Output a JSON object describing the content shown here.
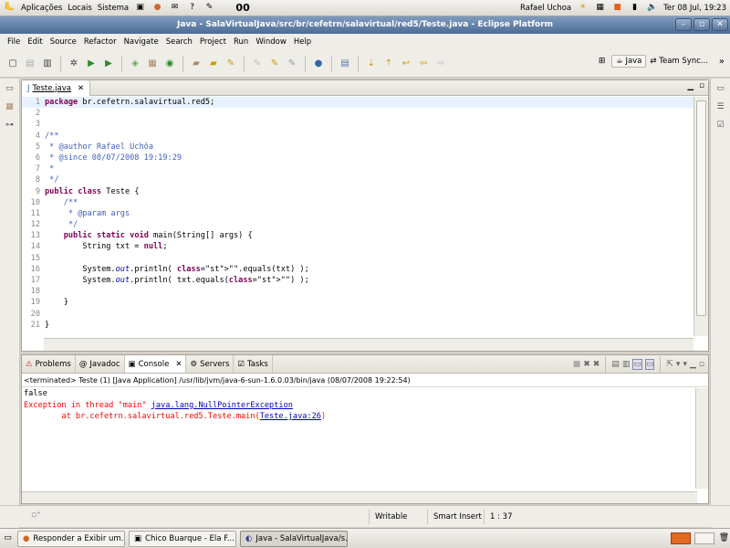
{
  "top_panel": {
    "menus": [
      "Aplicações",
      "Locais",
      "Sistema"
    ],
    "user": "Rafael Uchoa",
    "clock": "Ter 08 Jul, 19:23"
  },
  "window": {
    "title": "Java - SalaVirtualJava/src/br/cefetrn/salavirtual/red5/Teste.java - Eclipse Platform"
  },
  "menubar": [
    "File",
    "Edit",
    "Source",
    "Refactor",
    "Navigate",
    "Search",
    "Project",
    "Run",
    "Window",
    "Help"
  ],
  "perspectives": {
    "java": "Java",
    "team": "Team Sync..."
  },
  "editor": {
    "tab_label": "Teste.java",
    "line_numbers": [
      "1",
      "2",
      "3",
      "4",
      "5",
      "6",
      "7",
      "8",
      "9",
      "10",
      "11",
      "12",
      "13",
      "14",
      "15",
      "16",
      "17",
      "18",
      "19",
      "20",
      "21"
    ],
    "lines": [
      "package br.cefetrn.salavirtual.red5;",
      "",
      "",
      "/**",
      " * @author Rafael Uchôa",
      " * @since 08/07/2008 19:19:29",
      " *",
      " */",
      "public class Teste {",
      "    /**",
      "     * @param args",
      "     */",
      "    public static void main(String[] args) {",
      "        String txt = null;",
      "",
      "        System.out.println( \"\".equals(txt) );",
      "        System.out.println( txt.equals(\"\") );",
      "",
      "    }",
      "",
      "}"
    ]
  },
  "console": {
    "tabs": [
      "Problems",
      "Javadoc",
      "Console",
      "Servers",
      "Tasks"
    ],
    "header": "<terminated> Teste (1) [Java Application] /usr/lib/jvm/java-6-sun-1.6.0.03/bin/java (08/07/2008 19:22:54)",
    "out_false": "false",
    "exc_prefix": "Exception in thread \"main\" ",
    "exc_link": "java.lang.NullPointerException",
    "trace_prefix": "        at br.cefetrn.salavirtual.red5.Teste.main(",
    "trace_link": "Teste.java:26",
    "trace_suffix": ")"
  },
  "status": {
    "writable": "Writable",
    "insert_mode": "Smart Insert",
    "position": "1 : 37"
  },
  "taskbar": {
    "tasks": [
      "Responder a Exibir um...",
      "Chico Buarque - Ela F...",
      "Java - SalaVirtualJava/s..."
    ]
  },
  "colors": {
    "keyword": "#7f0055",
    "comment": "#3f5fbf",
    "error": "#ff0000",
    "titlebar": "#4d6c94"
  }
}
